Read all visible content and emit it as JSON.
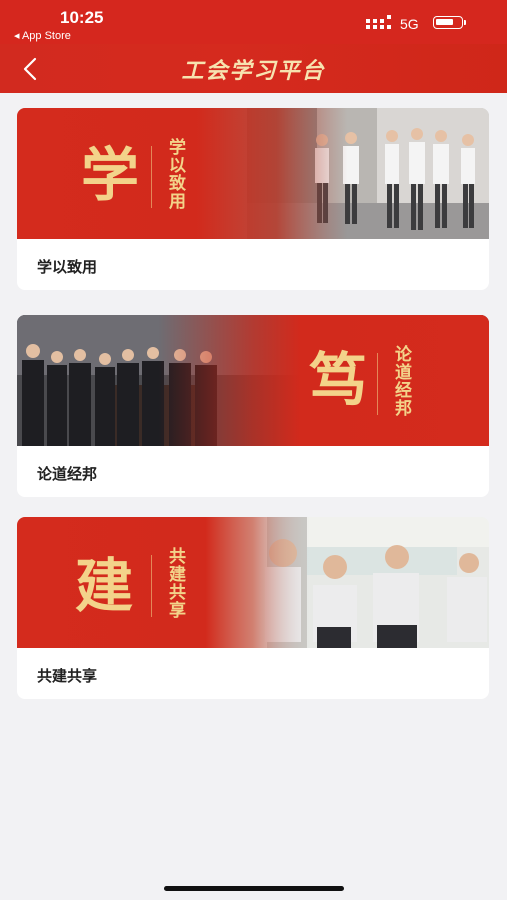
{
  "status_bar": {
    "time": "10:25",
    "back_label": "◂ App Store",
    "network": "5G"
  },
  "nav": {
    "title": "工会学习平台",
    "accent_color": "#d5271e"
  },
  "cards": [
    {
      "big_char": "学",
      "vertical_text": "学以致用",
      "label": "学以致用"
    },
    {
      "big_char": "笃",
      "vertical_text": "论道经邦",
      "label": "论道经邦"
    },
    {
      "big_char": "建",
      "vertical_text": "共建共享",
      "label": "共建共享"
    }
  ]
}
